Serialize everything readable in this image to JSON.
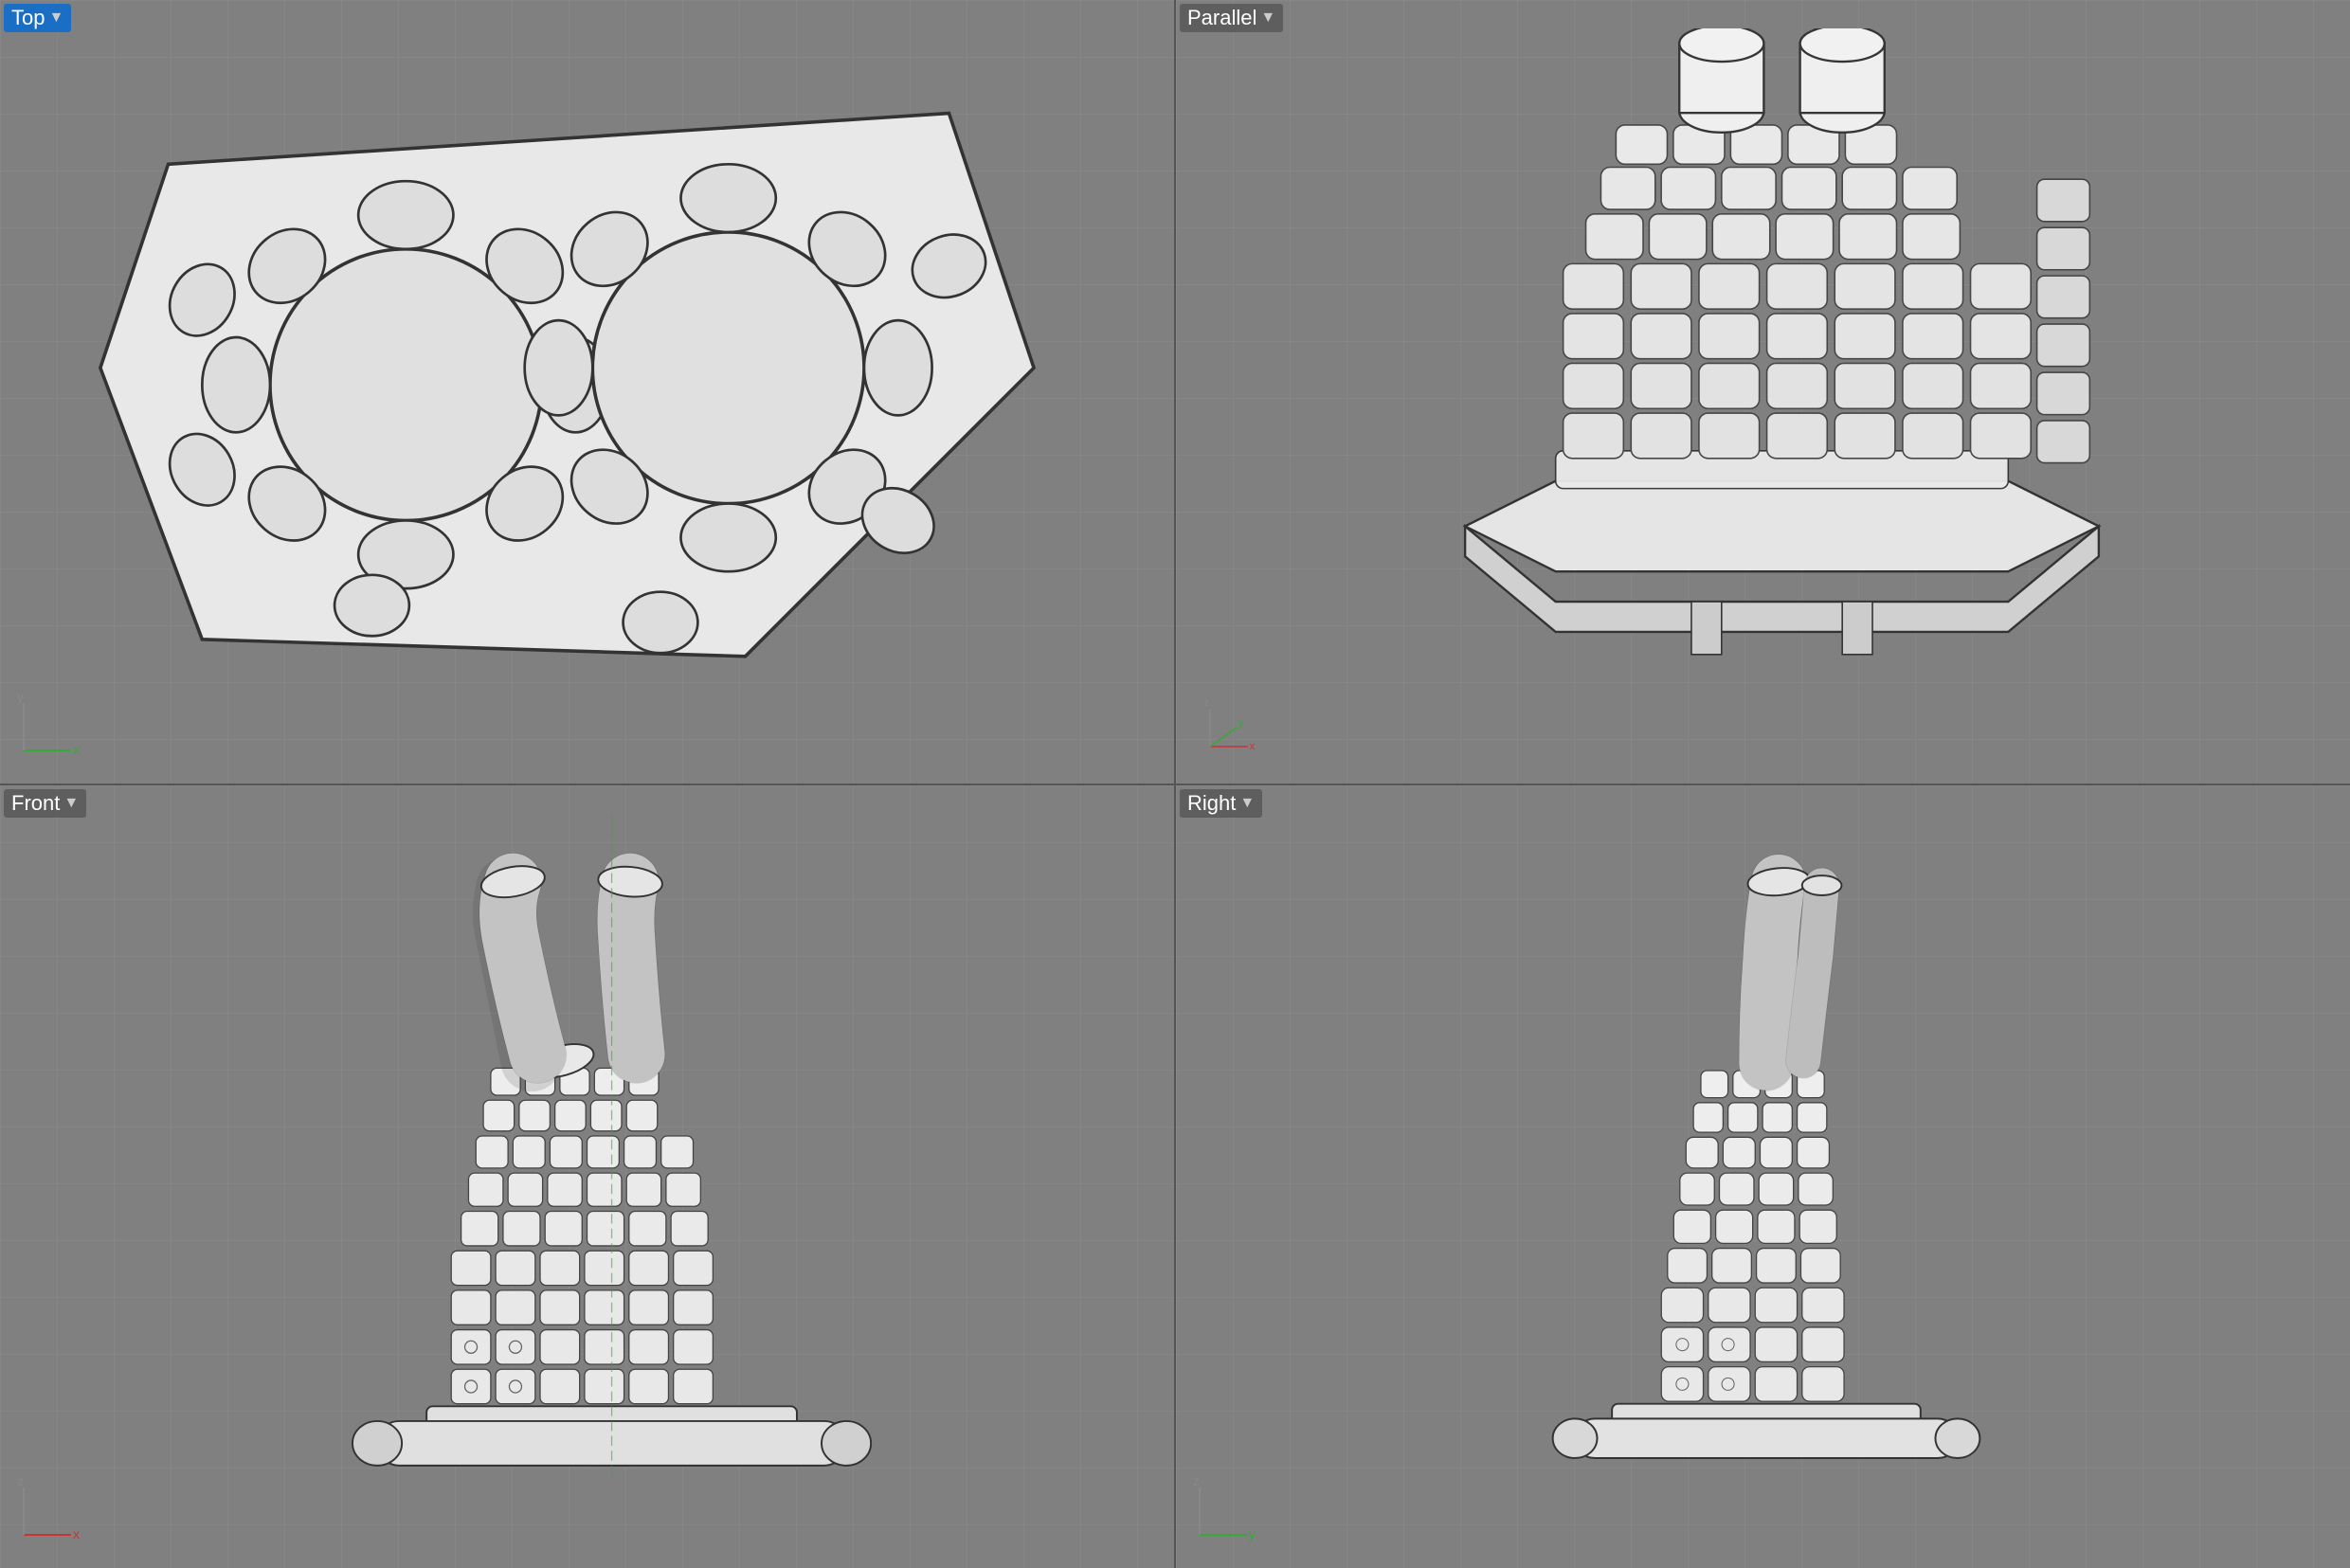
{
  "viewports": {
    "top": {
      "label": "Top",
      "style": "active",
      "axes": {
        "x": "x",
        "y": "y"
      }
    },
    "parallel": {
      "label": "Parallel",
      "style": "normal",
      "axes": {
        "x": "x",
        "y": "y",
        "z": "z"
      }
    },
    "front": {
      "label": "Front",
      "style": "normal",
      "axes": {
        "x": "x",
        "z": "z"
      }
    },
    "right": {
      "label": "Right",
      "style": "normal",
      "axes": {
        "y": "y",
        "z": "z"
      }
    }
  },
  "colors": {
    "bg": "#808080",
    "grid": "#909090",
    "object_fill": "#f0f0f0",
    "object_stroke": "#333333",
    "active_label_bg": "#1a6fc4",
    "axis_x": "#cc3333",
    "axis_y": "#33aa33",
    "axis_z": "#3333cc"
  }
}
